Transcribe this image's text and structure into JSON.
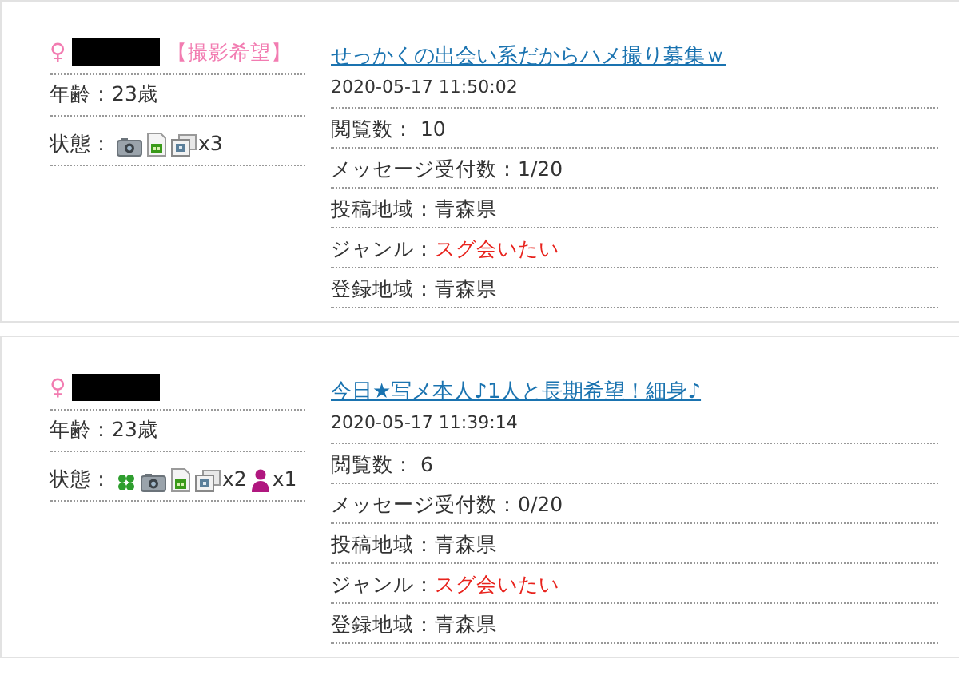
{
  "posts": [
    {
      "gender": "♀",
      "tag": "【撮影希望】",
      "age_label": "年齢：",
      "age": "23歳",
      "status_label": "状態：",
      "status": [
        {
          "kind": "camera"
        },
        {
          "kind": "document"
        },
        {
          "kind": "photos",
          "count": "x3"
        }
      ],
      "title": "せっかくの出会い系だからハメ撮り募集ｗ",
      "date": "2020-05-17 11:50:02",
      "fields": [
        {
          "label": "閲覧数：",
          "value": " 10",
          "kind": "plain"
        },
        {
          "label": "メッセージ受付数：",
          "value": "1/20",
          "kind": "plain"
        },
        {
          "label": "投稿地域：",
          "value": "青森県",
          "kind": "plain"
        },
        {
          "label": "ジャンル：",
          "value": "スグ会いたい",
          "kind": "highlight"
        },
        {
          "label": "登録地域：",
          "value": "青森県",
          "kind": "plain"
        }
      ]
    },
    {
      "gender": "♀",
      "age_label": "年齢：",
      "age": "23歳",
      "status_label": "状態：",
      "status": [
        {
          "kind": "clover"
        },
        {
          "kind": "camera"
        },
        {
          "kind": "document"
        },
        {
          "kind": "photos",
          "count": "x2"
        },
        {
          "kind": "person",
          "count": "x1"
        }
      ],
      "title": "今日★写メ本人♪1人と長期希望！細身♪",
      "date": "2020-05-17 11:39:14",
      "fields": [
        {
          "label": "閲覧数：",
          "value": " 6",
          "kind": "plain"
        },
        {
          "label": "メッセージ受付数：",
          "value": "0/20",
          "kind": "plain"
        },
        {
          "label": "投稿地域：",
          "value": "青森県",
          "kind": "plain"
        },
        {
          "label": "ジャンル：",
          "value": "スグ会いたい",
          "kind": "highlight"
        },
        {
          "label": "登録地域：",
          "value": "青森県",
          "kind": "plain"
        }
      ]
    }
  ]
}
